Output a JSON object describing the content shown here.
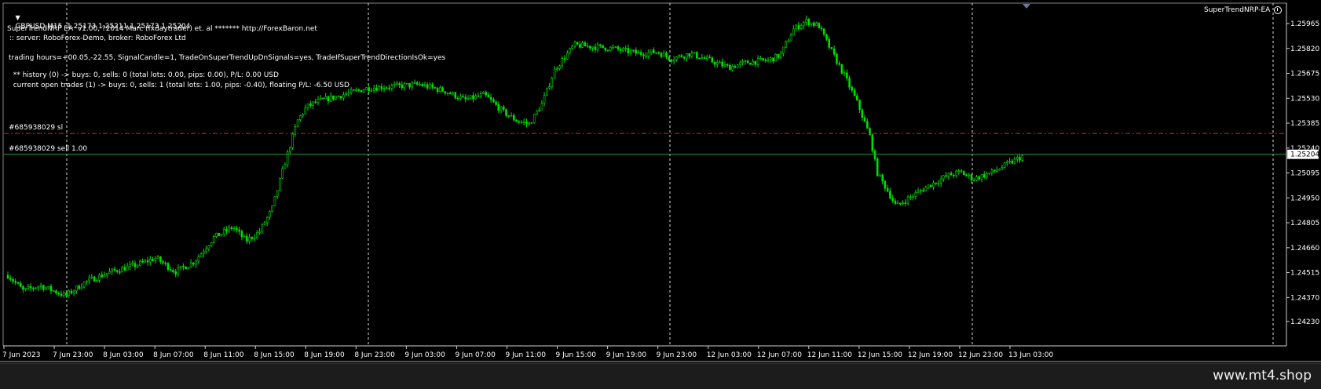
{
  "chart_header": {
    "symbol_text": "GBPUSD,M15  1.25173 1.25211 1.25173 1.25204",
    "ea_name": "SuperTrendNRP-EA"
  },
  "ea_info": {
    "line1": "SuperTrendNRP EA  v1.00, ?2014 Marc (fxdaytrader) et. al ******* http://ForexBaron.net",
    "line2": " :: server: RoboForex-Demo, broker: RoboForex Ltd",
    "line3": "trading hours=+00.05,-22.55, SignalCandle=1, TradeOnSuperTrendUpDnSignals=yes, TradeIfSuperTrendDirectionIsOk=yes",
    "line4": "  ** history (0) -> buys: 0, sells: 0 (total lots: 0.00, pips: 0.00), P/L: 0.00 USD",
    "line5": "  current open trades (1) -> buys: 0, sells: 1 (total lots: 1.00, pips: -0.40), floating P/L: -6.50 USD"
  },
  "order_lines": {
    "sl_label": "#685938029 sl",
    "sell_label": "#685938029 sell 1.00",
    "sl_price": 1.25325,
    "sell_price": 1.25204,
    "sl_color": "#e02020",
    "sell_color": "#1e9e3a"
  },
  "current_price_label": "1.25204",
  "watermark": "www.mt4.shop",
  "colors": {
    "background": "#000000",
    "candle": "#00e000",
    "grid": "#d8d8d8",
    "text": "#ffffff"
  },
  "chart_data": {
    "type": "candlestick",
    "symbol": "GBPUSD",
    "timeframe": "M15",
    "ylim": [
      1.2423,
      1.2604
    ],
    "y_ticks": [
      "1.25965",
      "1.25820",
      "1.25675",
      "1.25530",
      "1.25385",
      "1.25240",
      "1.25095",
      "1.24950",
      "1.24805",
      "1.24660",
      "1.24515",
      "1.24370",
      "1.24230"
    ],
    "x_ticks": [
      "7 Jun 2023",
      "7 Jun 23:00",
      "8 Jun 03:00",
      "8 Jun 07:00",
      "8 Jun 11:00",
      "8 Jun 15:00",
      "8 Jun 19:00",
      "8 Jun 23:00",
      "9 Jun 03:00",
      "9 Jun 07:00",
      "9 Jun 11:00",
      "9 Jun 15:00",
      "9 Jun 19:00",
      "9 Jun 23:00",
      "12 Jun 03:00",
      "12 Jun 07:00",
      "12 Jun 11:00",
      "12 Jun 15:00",
      "12 Jun 19:00",
      "12 Jun 23:00",
      "13 Jun 03:00"
    ],
    "price_path": [
      [
        0,
        1.245
      ],
      [
        0.012,
        1.2441
      ],
      [
        0.025,
        1.2444
      ],
      [
        0.045,
        1.2438
      ],
      [
        0.06,
        1.2446
      ],
      [
        0.08,
        1.2452
      ],
      [
        0.1,
        1.2456
      ],
      [
        0.115,
        1.246
      ],
      [
        0.13,
        1.2452
      ],
      [
        0.145,
        1.2458
      ],
      [
        0.16,
        1.2472
      ],
      [
        0.175,
        1.2478
      ],
      [
        0.185,
        1.247
      ],
      [
        0.195,
        1.2475
      ],
      [
        0.205,
        1.2488
      ],
      [
        0.215,
        1.2515
      ],
      [
        0.225,
        1.254
      ],
      [
        0.232,
        1.2548
      ],
      [
        0.24,
        1.2551
      ],
      [
        0.26,
        1.2555
      ],
      [
        0.28,
        1.2559
      ],
      [
        0.3,
        1.256
      ],
      [
        0.32,
        1.2561
      ],
      [
        0.34,
        1.2557
      ],
      [
        0.355,
        1.2552
      ],
      [
        0.37,
        1.2555
      ],
      [
        0.385,
        1.2545
      ],
      [
        0.395,
        1.254
      ],
      [
        0.405,
        1.2538
      ],
      [
        0.415,
        1.255
      ],
      [
        0.425,
        1.257
      ],
      [
        0.44,
        1.2584
      ],
      [
        0.455,
        1.2583
      ],
      [
        0.47,
        1.2582
      ],
      [
        0.49,
        1.2579
      ],
      [
        0.505,
        1.258
      ],
      [
        0.515,
        1.2576
      ],
      [
        0.53,
        1.2579
      ],
      [
        0.545,
        1.2575
      ],
      [
        0.56,
        1.2571
      ],
      [
        0.575,
        1.2574
      ],
      [
        0.59,
        1.2575
      ],
      [
        0.6,
        1.2578
      ],
      [
        0.61,
        1.2593
      ],
      [
        0.62,
        1.2598
      ],
      [
        0.63,
        1.2595
      ],
      [
        0.64,
        1.258
      ],
      [
        0.65,
        1.2566
      ],
      [
        0.66,
        1.255
      ],
      [
        0.67,
        1.253
      ],
      [
        0.675,
        1.251
      ],
      [
        0.685,
        1.2497
      ],
      [
        0.69,
        1.249
      ],
      [
        0.7,
        1.2495
      ],
      [
        0.715,
        1.2502
      ],
      [
        0.73,
        1.2508
      ],
      [
        0.74,
        1.251
      ],
      [
        0.75,
        1.2506
      ],
      [
        0.765,
        1.251
      ],
      [
        0.775,
        1.2514
      ],
      [
        0.785,
        1.2518
      ],
      [
        0.79,
        1.252
      ]
    ]
  }
}
